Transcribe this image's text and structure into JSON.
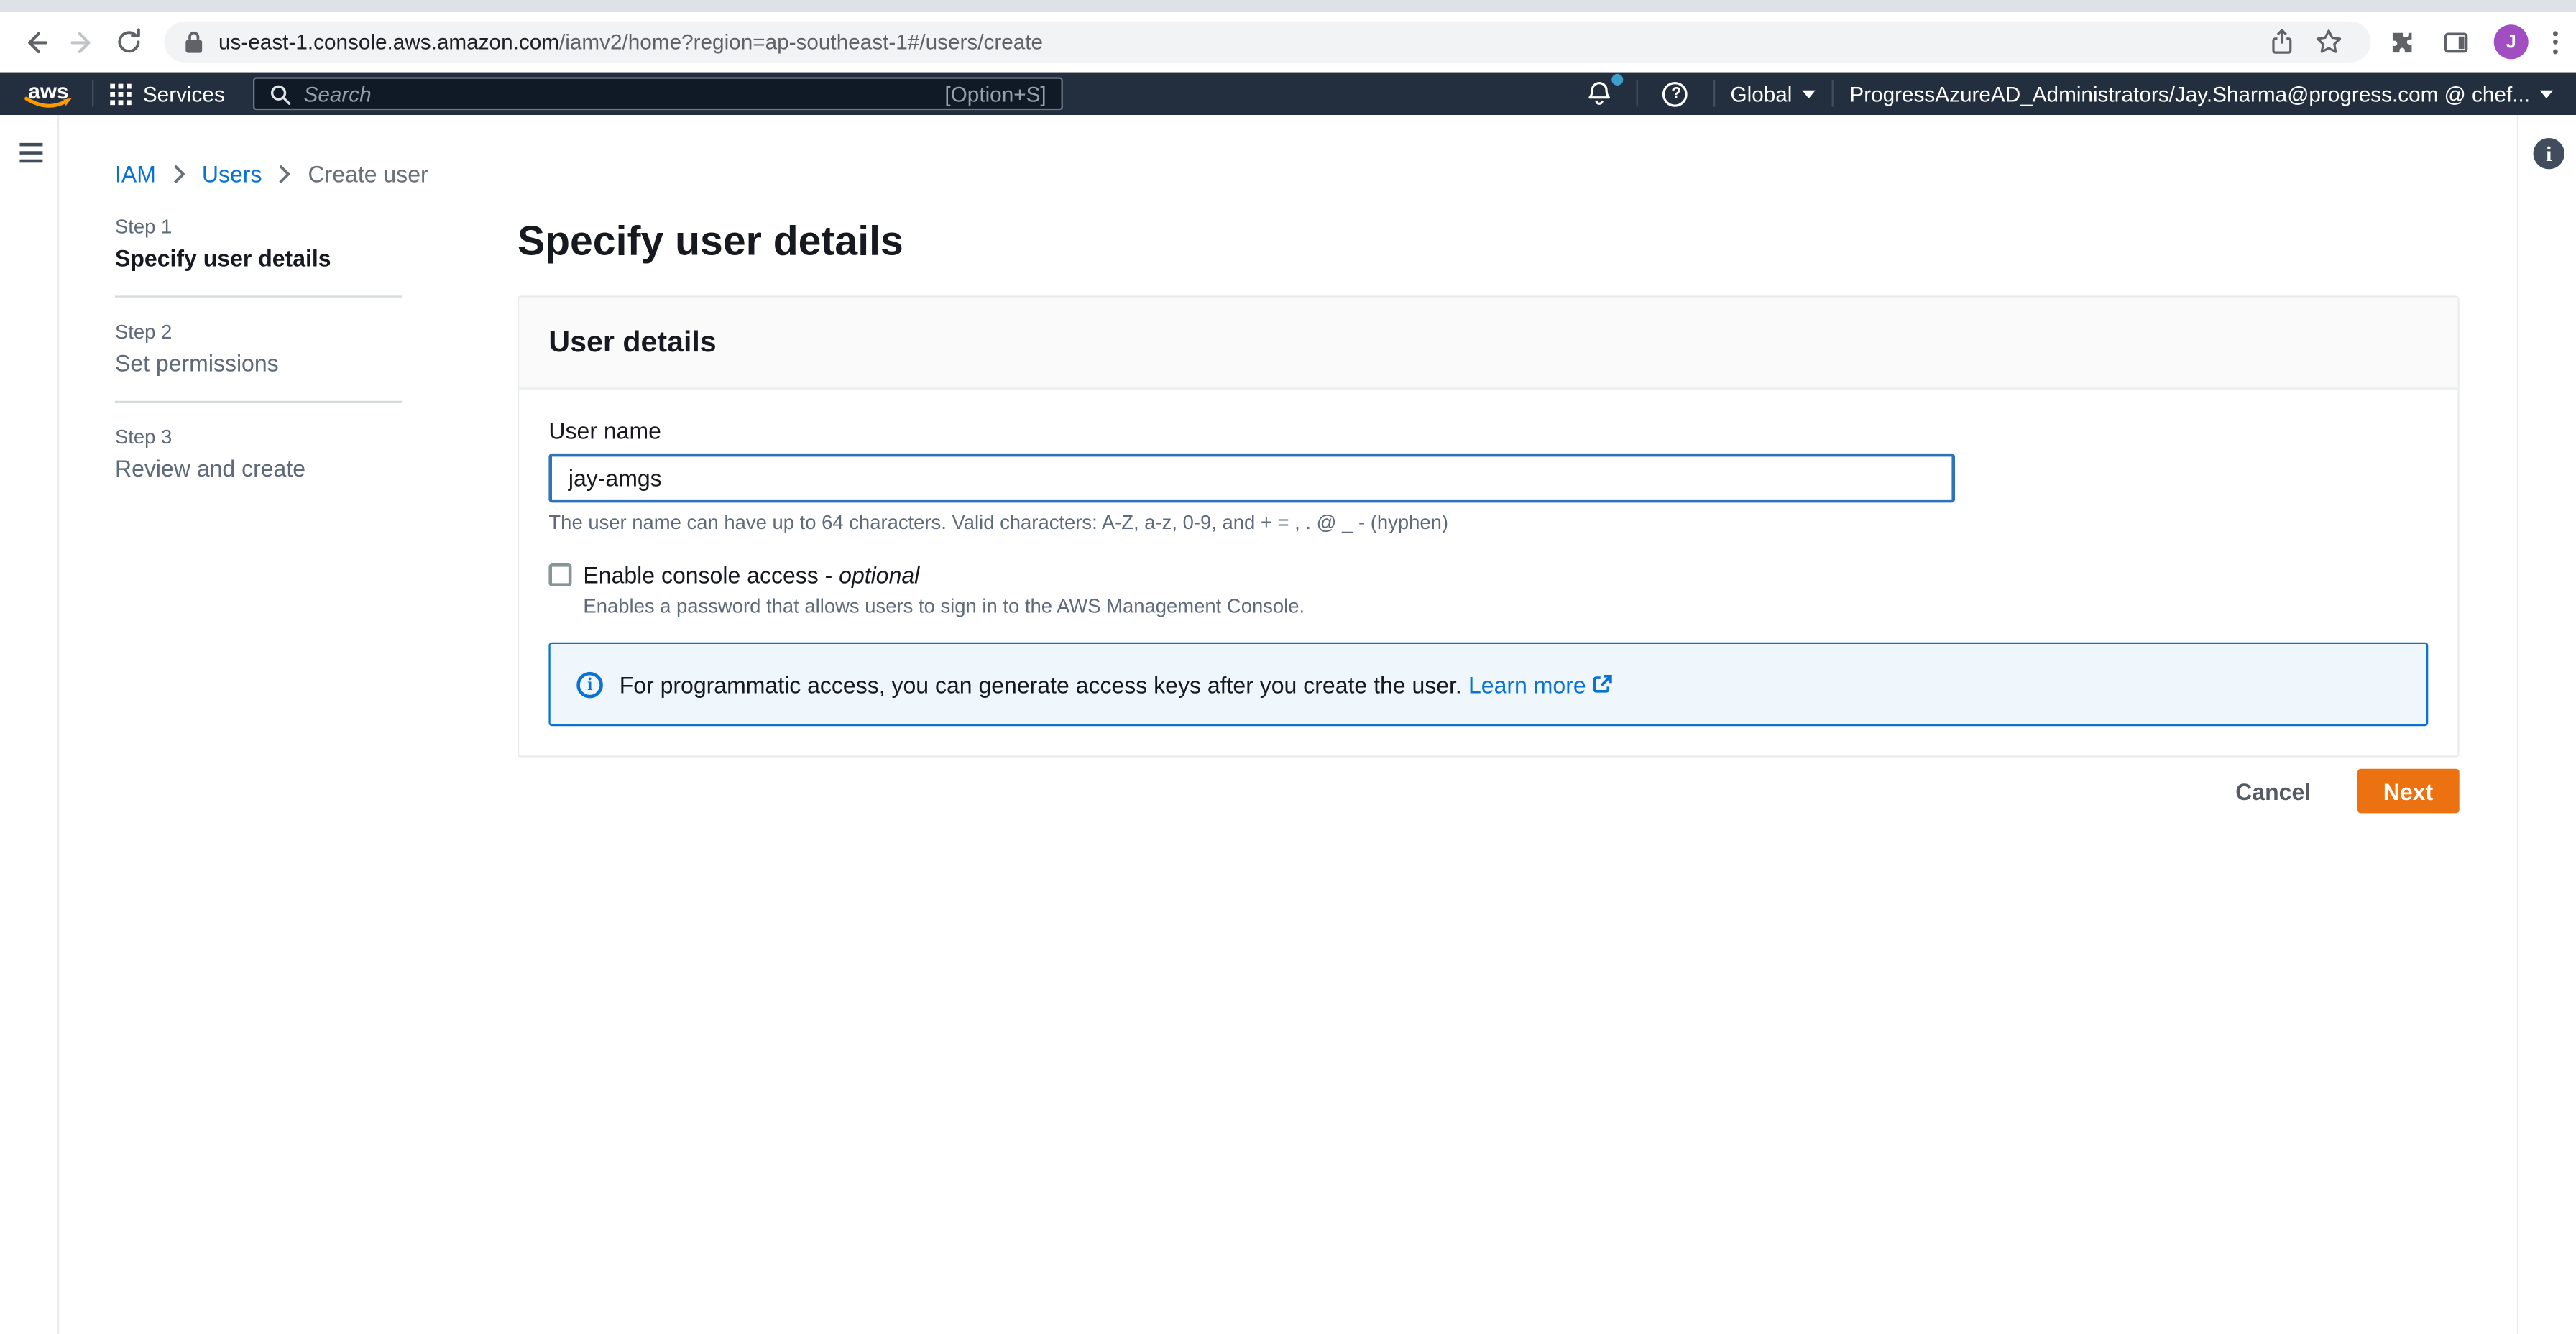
{
  "browser": {
    "url_domain": "us-east-1.console.aws.amazon.com",
    "url_path": "/iamv2/home?region=ap-southeast-1#/users/create",
    "avatar_letter": "J"
  },
  "nav": {
    "logo": "aws",
    "services_label": "Services",
    "search_placeholder": "Search",
    "search_shortcut": "[Option+S]",
    "help_glyph": "?",
    "region_label": "Global",
    "account_label": "ProgressAzureAD_Administrators/Jay.Sharma@progress.com @ chef...",
    "colors": {
      "bar_bg": "#232f3e",
      "logo_smile": "#ff9900",
      "notification_dot": "#3e9fcc"
    }
  },
  "breadcrumb": {
    "items": [
      {
        "label": "IAM"
      },
      {
        "label": "Users"
      },
      {
        "label": "Create user"
      }
    ]
  },
  "rail": {
    "info_toggle_glyph": "i"
  },
  "steps": [
    {
      "step": "Step 1",
      "title": "Specify user details",
      "active": true
    },
    {
      "step": "Step 2",
      "title": "Set permissions",
      "active": false
    },
    {
      "step": "Step 3",
      "title": "Review and create",
      "active": false
    }
  ],
  "main": {
    "page_title": "Specify user details",
    "card": {
      "header": "User details",
      "username_label": "User name",
      "username_value": "jay-amgs",
      "username_constraint": "The user name can have up to 64 characters. Valid characters: A-Z, a-z, 0-9, and + = , . @ _ - (hyphen)",
      "console_access_label": "Enable console access - ",
      "console_access_optional": "optional",
      "console_access_description": "Enables a password that allows users to sign in to the AWS Management Console.",
      "info_icon_glyph": "i",
      "info_alert_text": "For programmatic access, you can generate access keys after you create the user. ",
      "info_alert_link": "Learn more"
    },
    "actions": {
      "cancel_label": "Cancel",
      "next_label": "Next"
    },
    "colors": {
      "primary_button": "#ec7211",
      "link": "#0972d3",
      "alert_bg": "#f0f7fc",
      "alert_border": "#0972d3",
      "input_focus_border": "#2e73b8"
    }
  }
}
